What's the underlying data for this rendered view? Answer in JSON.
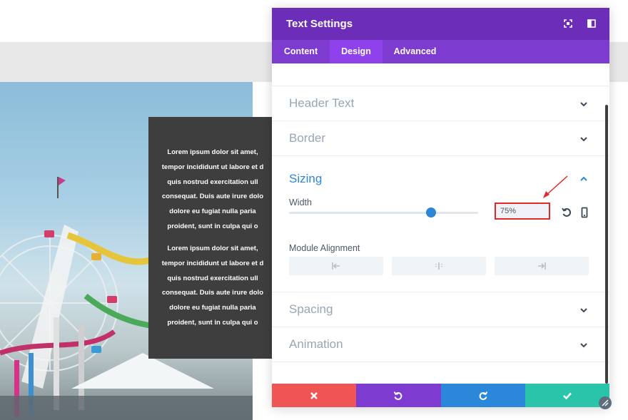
{
  "modal": {
    "title": "Text Settings",
    "header_icons": [
      "fullscreen-icon",
      "sidebar-toggle-icon"
    ],
    "tabs": [
      {
        "label": "Content",
        "active": false
      },
      {
        "label": "Design",
        "active": true
      },
      {
        "label": "Advanced",
        "active": false
      }
    ],
    "sections": {
      "header_text": {
        "title": "Header Text",
        "expanded": false
      },
      "border": {
        "title": "Border",
        "expanded": false
      },
      "sizing": {
        "title": "Sizing",
        "expanded": true,
        "width_label": "Width",
        "width_value": "75%",
        "width_fraction": 0.75,
        "module_alignment_label": "Module Alignment",
        "alignment_options": [
          "left",
          "center",
          "right"
        ]
      },
      "spacing": {
        "title": "Spacing",
        "expanded": false
      },
      "animation": {
        "title": "Animation",
        "expanded": false
      }
    },
    "footer": [
      {
        "action": "cancel",
        "icon": "close-icon",
        "color": "#ef5555"
      },
      {
        "action": "undo",
        "icon": "undo-icon",
        "color": "#7e3bd0"
      },
      {
        "action": "redo",
        "icon": "redo-icon",
        "color": "#2b87da"
      },
      {
        "action": "save",
        "icon": "check-icon",
        "color": "#29c4a9"
      }
    ]
  },
  "colors": {
    "header_purple": "#6c2eb9",
    "tabs_purple": "#7e3bd0",
    "active_tab": "#8f42ec",
    "accent_blue": "#2e87d6",
    "highlight_red": "#e02b2b"
  },
  "preview_text": {
    "paragraph1": [
      "Lorem ipsum dolor sit amet,",
      "tempor incididunt ut labore et d",
      "quis nostrud exercitation ull",
      "consequat. Duis aute irure dolo",
      "dolore eu fugiat nulla paria",
      "proident, sunt in culpa qui o"
    ],
    "paragraph2": [
      "Lorem ipsum dolor sit amet,",
      "tempor incididunt ut labore et d",
      "quis nostrud exercitation ull",
      "consequat. Duis aute irure dolo",
      "dolore eu fugiat nulla paria",
      "proident, sunt in culpa qui o"
    ]
  }
}
